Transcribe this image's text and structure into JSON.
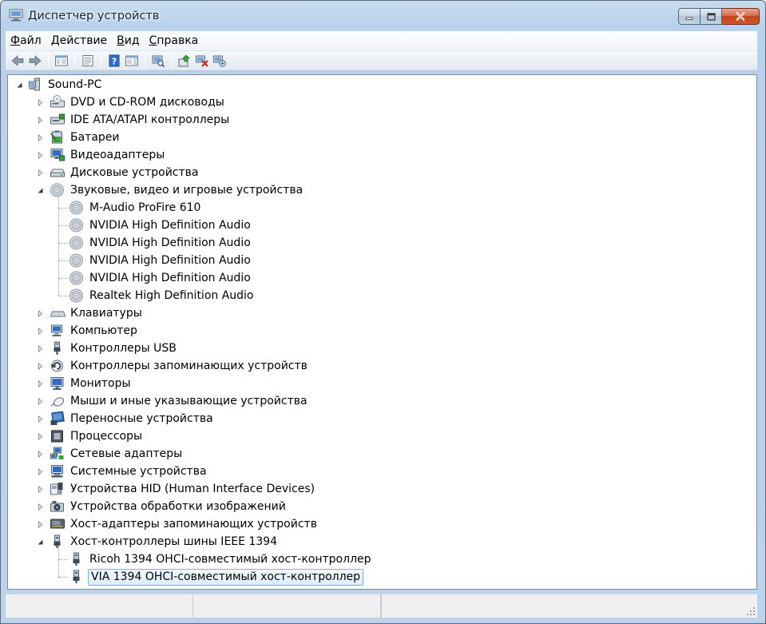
{
  "window": {
    "title": "Диспетчер устройств",
    "icon": "device-manager-icon"
  },
  "menu": {
    "items": [
      {
        "label": "Файл",
        "accel": "Ф",
        "rest": "айл"
      },
      {
        "label": "Действие",
        "accel": "Д",
        "rest": "ействие"
      },
      {
        "label": "Вид",
        "accel": "В",
        "rest": "ид"
      },
      {
        "label": "Справка",
        "accel": "С",
        "rest": "правка"
      }
    ]
  },
  "toolbar": {
    "buttons": [
      "back-icon",
      "forward-icon",
      "show-hide-console-tree-icon",
      "properties-icon",
      "help-icon",
      "action-pane-icon",
      "scan-hardware-icon",
      "update-driver-icon",
      "uninstall-icon",
      "enable-device-icon"
    ]
  },
  "tree": {
    "root": "Sound-PC",
    "categories": [
      {
        "label": "DVD и CD-ROM дисководы",
        "icon": "dvd-drive-icon",
        "expanded": false
      },
      {
        "label": "IDE ATA/ATAPI контроллеры",
        "icon": "ide-controller-icon",
        "expanded": false
      },
      {
        "label": "Батареи",
        "icon": "battery-icon",
        "expanded": false
      },
      {
        "label": "Видеоадаптеры",
        "icon": "display-adapter-icon",
        "expanded": false
      },
      {
        "label": "Дисковые устройства",
        "icon": "disk-drive-icon",
        "expanded": false
      },
      {
        "label": "Звуковые, видео и игровые устройства",
        "icon": "speaker-icon",
        "expanded": true,
        "children": [
          {
            "label": "M-Audio ProFire 610",
            "icon": "speaker-icon"
          },
          {
            "label": "NVIDIA High Definition Audio",
            "icon": "speaker-icon"
          },
          {
            "label": "NVIDIA High Definition Audio",
            "icon": "speaker-icon"
          },
          {
            "label": "NVIDIA High Definition Audio",
            "icon": "speaker-icon"
          },
          {
            "label": "NVIDIA High Definition Audio",
            "icon": "speaker-icon"
          },
          {
            "label": "Realtek High Definition Audio",
            "icon": "speaker-icon"
          }
        ]
      },
      {
        "label": "Клавиатуры",
        "icon": "keyboard-icon",
        "expanded": false
      },
      {
        "label": "Компьютер",
        "icon": "computer-icon",
        "expanded": false
      },
      {
        "label": "Контроллеры USB",
        "icon": "usb-icon",
        "expanded": false
      },
      {
        "label": "Контроллеры запоминающих устройств",
        "icon": "storage-controller-icon",
        "expanded": false
      },
      {
        "label": "Мониторы",
        "icon": "monitor-icon",
        "expanded": false
      },
      {
        "label": "Мыши и иные указывающие устройства",
        "icon": "mouse-icon",
        "expanded": false
      },
      {
        "label": "Переносные устройства",
        "icon": "portable-device-icon",
        "expanded": false
      },
      {
        "label": "Процессоры",
        "icon": "processor-icon",
        "expanded": false
      },
      {
        "label": "Сетевые адаптеры",
        "icon": "network-adapter-icon",
        "expanded": false
      },
      {
        "label": "Системные устройства",
        "icon": "system-device-icon",
        "expanded": false
      },
      {
        "label": "Устройства HID (Human Interface Devices)",
        "icon": "hid-icon",
        "expanded": false
      },
      {
        "label": "Устройства обработки изображений",
        "icon": "imaging-device-icon",
        "expanded": false
      },
      {
        "label": "Хост-адаптеры запоминающих устройств",
        "icon": "storage-host-adapter-icon",
        "expanded": false
      },
      {
        "label": "Хост-контроллеры шины IEEE 1394",
        "icon": "ieee1394-icon",
        "expanded": true,
        "children": [
          {
            "label": "Ricoh 1394 OHCI-совместимый хост-контроллер",
            "icon": "ieee1394-icon"
          },
          {
            "label": "VIA 1394 OHCI-совместимый хост-контроллер",
            "icon": "ieee1394-icon",
            "selected": true
          }
        ]
      }
    ]
  },
  "colors": {
    "selection_border": "#84acdd",
    "selection_fill": "#dfecfb",
    "titlebar": "#b9d1ea",
    "close_button": "#c2441f"
  }
}
